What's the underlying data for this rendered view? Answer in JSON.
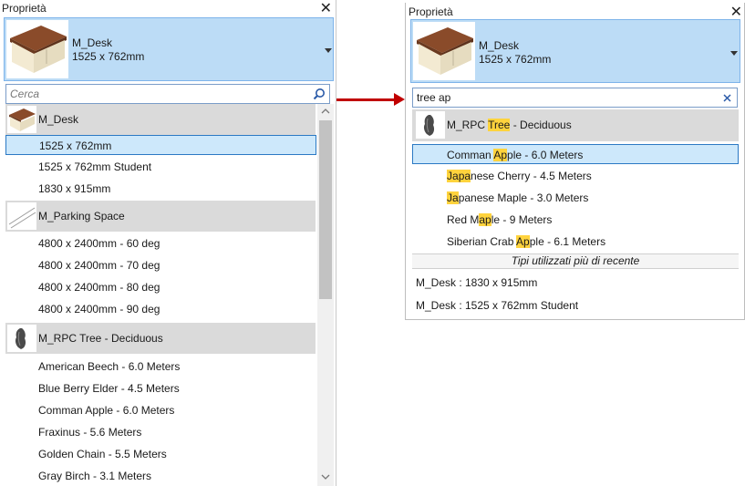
{
  "left": {
    "title": "Proprietà",
    "selector": {
      "name": "M_Desk",
      "size": "1525 x 762mm"
    },
    "search_placeholder": "Cerca",
    "families": [
      {
        "name": "M_Desk",
        "types": [
          "1525 x 762mm",
          "1525 x 762mm Student",
          "1830 x 915mm"
        ]
      },
      {
        "name": "M_Parking Space",
        "types": [
          "4800 x 2400mm - 60 deg",
          "4800 x 2400mm - 70 deg",
          "4800 x 2400mm - 80 deg",
          "4800 x 2400mm - 90 deg"
        ]
      },
      {
        "name": "M_RPC Tree - Deciduous",
        "types": [
          "American Beech - 6.0 Meters",
          "Blue Berry Elder - 4.5 Meters",
          "Comman Apple - 6.0 Meters",
          "Fraxinus - 5.6 Meters",
          "Golden Chain - 5.5 Meters",
          "Gray Birch - 3.1 Meters"
        ]
      }
    ],
    "selected_type": "1525 x 762mm"
  },
  "right": {
    "title": "Proprietà",
    "selector": {
      "name": "M_Desk",
      "size": "1525 x 762mm"
    },
    "search_value": "tree ap",
    "family": {
      "name": "M_RPC Tree - Deciduous"
    },
    "types": [
      "Comman Apple - 6.0 Meters",
      "Japanese Cherry - 4.5 Meters",
      "Japanese Maple - 3.0 Meters",
      "Red Maple - 9 Meters",
      "Siberian Crab Apple - 6.1 Meters"
    ],
    "recent_header": "Tipi utilizzati più di recente",
    "recent": [
      "M_Desk : 1830 x 915mm",
      "M_Desk : 1525 x 762mm Student"
    ]
  },
  "colors": {
    "selected_bg": "#cde8fb",
    "highlight": "#ffd33d",
    "arrow": "#c00000",
    "selector_bg": "#bcdcf6"
  },
  "icons": [
    "close-icon",
    "search-icon",
    "clear-icon",
    "dropdown-arrow-icon",
    "scroll-up-icon",
    "scroll-down-icon",
    "arrow-right-icon"
  ]
}
